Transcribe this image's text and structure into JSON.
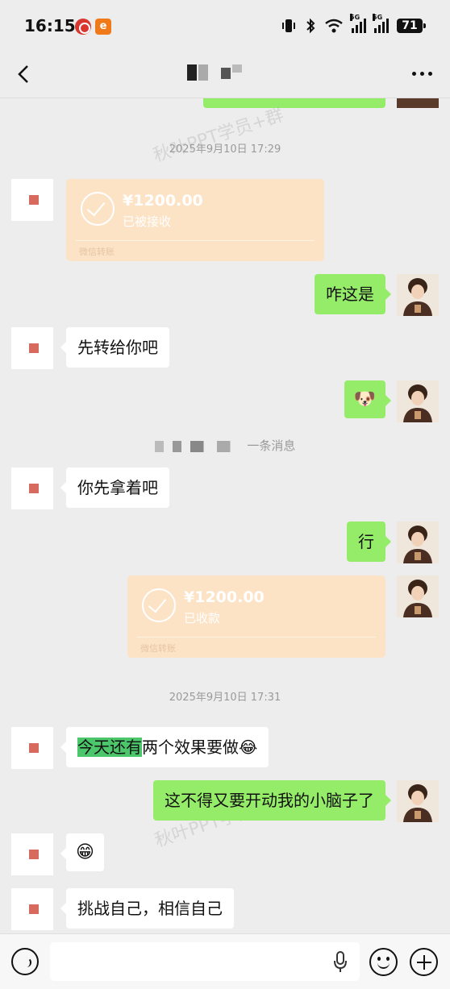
{
  "status_bar": {
    "time": "16:15",
    "app_icon_2_glyph": "e",
    "net_1": "5G",
    "net_2": "5G",
    "battery": "71"
  },
  "header": {
    "back_icon": "chevron-left-icon",
    "more_icon": "more-dots-icon"
  },
  "watermark": "秋叶PPT学员+群",
  "timestamps": [
    "2025年9月10日 17:29",
    "2025年9月10日 17:31"
  ],
  "system_notice": "一条消息",
  "transfers": [
    {
      "amount": "¥1200.00",
      "status": "已被接收",
      "footer": "微信转账"
    },
    {
      "amount": "¥1200.00",
      "status": "已收款",
      "footer": "微信转账"
    }
  ],
  "messages": {
    "m1": "咋这是",
    "m2": "先转给你吧",
    "m3_emoji": "🐶",
    "m4": "你先拿着吧",
    "m5": "行",
    "m6_highlight": "今天还有",
    "m6_rest": "两个效果要做",
    "m6_emoji": "😂",
    "m7": "这不得又要开动我的小脑子了",
    "m8_emoji": "😁",
    "m9": "挑战自己，相信自己"
  },
  "input_bar": {
    "voice_icon": "voice-icon",
    "mic_icon": "mic-icon",
    "emoji_icon": "emoji-icon",
    "plus_icon": "plus-icon"
  },
  "colors": {
    "background": "#ededed",
    "outgoing_bubble": "#95ec69",
    "incoming_bubble": "#ffffff",
    "transfer_card": "#fde3c6"
  }
}
